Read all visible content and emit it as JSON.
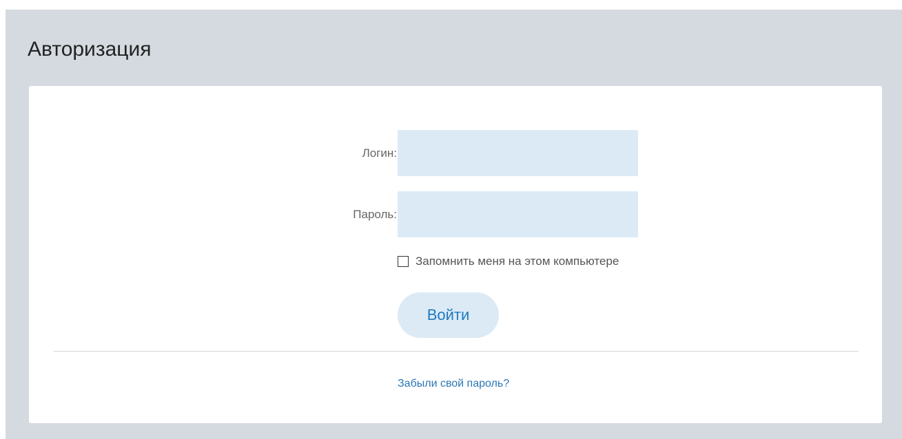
{
  "page": {
    "title": "Авторизация"
  },
  "form": {
    "login_label": "Логин:",
    "login_value": "",
    "password_label": "Пароль:",
    "password_value": "",
    "remember_label": "Запомнить меня на этом компьютере",
    "remember_checked": false,
    "submit_label": "Войти",
    "forgot_link": "Забыли свой пароль?"
  },
  "colors": {
    "page_background": "#d5dae1",
    "input_background": "#dbeaf5",
    "accent": "#1f79be",
    "link": "#2b76b4"
  }
}
